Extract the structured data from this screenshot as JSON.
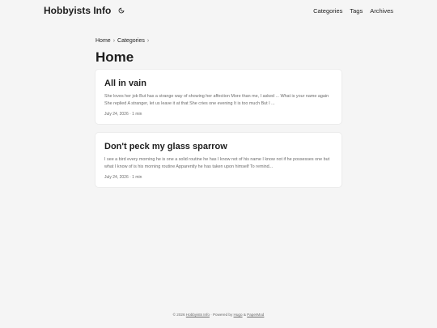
{
  "header": {
    "logo": "Hobbyists Info",
    "theme_icon": "moon-icon",
    "nav": [
      "Categories",
      "Tags",
      "Archives"
    ]
  },
  "breadcrumb": [
    "Home",
    "Categories"
  ],
  "page_title": "Home",
  "posts": [
    {
      "title": "All in vain",
      "excerpt": "She loves her job But has a strange way of showing her affection More than me, I asked ... What is your name again She replied A stranger, let us leave it at that She cries one evening It is too much But I ...",
      "meta": "July 24, 2026 · 1 min"
    },
    {
      "title": "Don't peck my glass sparrow",
      "excerpt": "I see a bird every morning he is one a solid routine he has I know not of his name I know not if he possesses one but what I know of is his morning routine Apparently he has taken upon himself To remind...",
      "meta": "July 24, 2026 · 1 min"
    }
  ],
  "footer": {
    "copyright": "© 2026",
    "site_link": "Hobbyists Info",
    "powered_by": "· Powered by",
    "hugo": "Hugo",
    "amp": "&",
    "papermod": "PaperMod"
  }
}
